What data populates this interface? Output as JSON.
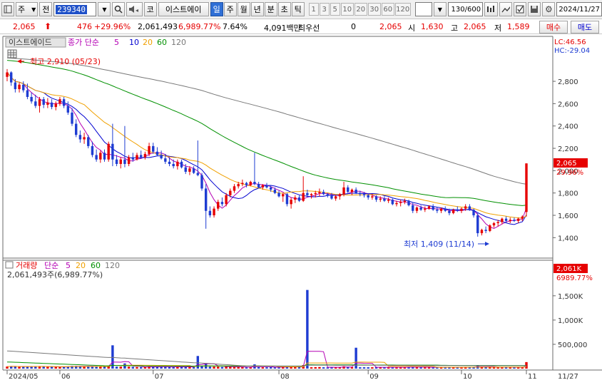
{
  "toolbar": {
    "type_selector": "주",
    "prefix_btn": "전",
    "stock_code": "239340",
    "exchange_btn": "코",
    "stock_name": "이스트에이",
    "periods": [
      "일",
      "주",
      "월",
      "년",
      "분",
      "초",
      "틱"
    ],
    "active_period": "일",
    "intervals": [
      "1",
      "3",
      "5",
      "10",
      "20",
      "30",
      "60",
      "120"
    ],
    "bar_count": "130",
    "bar_total": "/600",
    "date": "2024/11/27"
  },
  "quote": {
    "price": "2,065",
    "change": "476",
    "change_pct": "+29.96%",
    "volume": "2,061,493",
    "volume_pct": "6,989.77%",
    "turnover_pct": "7.64%",
    "amount": "4,091백만",
    "best_bid_label": "최우선",
    "best_bid_value": "0",
    "best_ask_value": "2,065",
    "open_label": "시",
    "open": "1,630",
    "high_label": "고",
    "high": "2,065",
    "low_label": "저",
    "low": "1,589",
    "buy_label": "매수",
    "sell_label": "매도"
  },
  "colors": {
    "up": "#e60000",
    "down": "#1e3cd2",
    "ma5": "#b400b4",
    "ma10": "#0000d0",
    "ma20": "#f0a000",
    "ma60": "#009000",
    "ma120": "#787878"
  },
  "price_panel": {
    "title": "이스트에이드",
    "legend_label": "종가 단순",
    "legend_periods": [
      "5",
      "10",
      "20",
      "60",
      "120"
    ],
    "lc": "LC:46.56",
    "hc": "HC:-29.04",
    "max_annotation": "최고 2,910 (05/23)",
    "min_annotation": "최저 1,409 (11/14)",
    "current_price": "2,065",
    "current_pct": "29.96%",
    "y_ticks": [
      "2,800",
      "2,600",
      "2,400",
      "2,200",
      "2,000",
      "1,800",
      "1,600",
      "1,400"
    ]
  },
  "volume_panel": {
    "legend_label": "거래량",
    "legend_sub": "단순",
    "legend_periods": [
      "5",
      "20",
      "60",
      "120"
    ],
    "info": "2,061,493주(6,989.77%)",
    "current_volume": "2,061K",
    "current_pct": "6989.77%",
    "y_ticks": [
      "1,500K",
      "1,000K",
      "500,000"
    ]
  },
  "x_axis": {
    "labels": [
      "2024/05",
      "06",
      "07",
      "08",
      "09",
      "10",
      "11"
    ],
    "right_label": "11/27"
  },
  "chart_data": {
    "type": "candlestick",
    "ylim": [
      1300,
      2960
    ],
    "volume_ylim": [
      0,
      2100000
    ],
    "candles": [
      [
        2840,
        2910,
        2800,
        2880
      ],
      [
        2880,
        2890,
        2760,
        2790
      ],
      [
        2790,
        2820,
        2700,
        2730
      ],
      [
        2730,
        2790,
        2700,
        2770
      ],
      [
        2770,
        2800,
        2700,
        2720
      ],
      [
        2720,
        2780,
        2640,
        2660
      ],
      [
        2660,
        2700,
        2600,
        2620
      ],
      [
        2620,
        2680,
        2560,
        2580
      ],
      [
        2580,
        2660,
        2520,
        2640
      ],
      [
        2640,
        2660,
        2560,
        2590
      ],
      [
        2590,
        2650,
        2560,
        2610
      ],
      [
        2610,
        2640,
        2550,
        2570
      ],
      [
        2570,
        2620,
        2540,
        2600
      ],
      [
        2600,
        2660,
        2580,
        2640
      ],
      [
        2640,
        2660,
        2560,
        2580
      ],
      [
        2580,
        2620,
        2500,
        2520
      ],
      [
        2520,
        2560,
        2400,
        2420
      ],
      [
        2420,
        2460,
        2300,
        2320
      ],
      [
        2320,
        2360,
        2250,
        2280
      ],
      [
        2280,
        2340,
        2240,
        2300
      ],
      [
        2300,
        2320,
        2200,
        2220
      ],
      [
        2220,
        2260,
        2120,
        2140
      ],
      [
        2140,
        2190,
        2080,
        2100
      ],
      [
        2100,
        2180,
        2070,
        2160
      ],
      [
        2160,
        2190,
        2080,
        2100
      ],
      [
        2100,
        2260,
        2080,
        2240
      ],
      [
        2240,
        2420,
        2040,
        2100
      ],
      [
        2100,
        2140,
        2040,
        2060
      ],
      [
        2060,
        2120,
        2020,
        2100
      ],
      [
        2100,
        2400,
        2030,
        2060
      ],
      [
        2060,
        2140,
        2040,
        2120
      ],
      [
        2120,
        2160,
        2080,
        2100
      ],
      [
        2100,
        2160,
        2090,
        2140
      ],
      [
        2140,
        2180,
        2110,
        2120
      ],
      [
        2120,
        2170,
        2100,
        2150
      ],
      [
        2150,
        2250,
        2130,
        2220
      ],
      [
        2220,
        2250,
        2150,
        2170
      ],
      [
        2170,
        2210,
        2130,
        2140
      ],
      [
        2140,
        2180,
        2100,
        2110
      ],
      [
        2110,
        2150,
        2060,
        2080
      ],
      [
        2080,
        2120,
        2040,
        2060
      ],
      [
        2060,
        2100,
        2020,
        2040
      ],
      [
        2040,
        2100,
        2010,
        2080
      ],
      [
        2080,
        2100,
        2020,
        2030
      ],
      [
        2030,
        2060,
        1970,
        1990
      ],
      [
        1990,
        2040,
        1960,
        2020
      ],
      [
        2020,
        2040,
        1970,
        1980
      ],
      [
        1980,
        2270,
        1950,
        1960
      ],
      [
        1960,
        1980,
        1820,
        1840
      ],
      [
        1840,
        1880,
        1480,
        1640
      ],
      [
        1640,
        1680,
        1580,
        1600
      ],
      [
        1600,
        1680,
        1580,
        1660
      ],
      [
        1660,
        1740,
        1640,
        1720
      ],
      [
        1720,
        1760,
        1680,
        1700
      ],
      [
        1700,
        1800,
        1680,
        1780
      ],
      [
        1780,
        1840,
        1760,
        1820
      ],
      [
        1820,
        1880,
        1800,
        1860
      ],
      [
        1860,
        1900,
        1840,
        1880
      ],
      [
        1880,
        1920,
        1860,
        1890
      ],
      [
        1890,
        1900,
        1850,
        1870
      ],
      [
        1870,
        1910,
        1860,
        1900
      ],
      [
        1900,
        2160,
        1870,
        1880
      ],
      [
        1880,
        1900,
        1840,
        1850
      ],
      [
        1850,
        1880,
        1830,
        1870
      ],
      [
        1870,
        1890,
        1840,
        1850
      ],
      [
        1850,
        1870,
        1810,
        1830
      ],
      [
        1830,
        1850,
        1790,
        1800
      ],
      [
        1800,
        1820,
        1760,
        1770
      ],
      [
        1770,
        1800,
        1720,
        1790
      ],
      [
        1790,
        1800,
        1680,
        1700
      ],
      [
        1700,
        1760,
        1660,
        1740
      ],
      [
        1740,
        1780,
        1710,
        1760
      ],
      [
        1760,
        1780,
        1720,
        1730
      ],
      [
        1730,
        1950,
        1720,
        1800
      ],
      [
        1800,
        1830,
        1760,
        1780
      ],
      [
        1780,
        1800,
        1750,
        1790
      ],
      [
        1790,
        1820,
        1760,
        1800
      ],
      [
        1800,
        1840,
        1770,
        1810
      ],
      [
        1810,
        1830,
        1780,
        1790
      ],
      [
        1790,
        1800,
        1760,
        1780
      ],
      [
        1780,
        1800,
        1740,
        1750
      ],
      [
        1750,
        1780,
        1730,
        1770
      ],
      [
        1770,
        1800,
        1740,
        1790
      ],
      [
        1790,
        1900,
        1770,
        1850
      ],
      [
        1850,
        1870,
        1790,
        1810
      ],
      [
        1810,
        1840,
        1780,
        1830
      ],
      [
        1830,
        1850,
        1790,
        1800
      ],
      [
        1800,
        1820,
        1770,
        1790
      ],
      [
        1790,
        1810,
        1760,
        1780
      ],
      [
        1780,
        1790,
        1740,
        1760
      ],
      [
        1760,
        1790,
        1740,
        1770
      ],
      [
        1770,
        1780,
        1720,
        1740
      ],
      [
        1740,
        1770,
        1720,
        1750
      ],
      [
        1750,
        1770,
        1720,
        1730
      ],
      [
        1730,
        1760,
        1710,
        1740
      ],
      [
        1740,
        1750,
        1690,
        1700
      ],
      [
        1700,
        1730,
        1680,
        1710
      ],
      [
        1710,
        1740,
        1680,
        1720
      ],
      [
        1720,
        1750,
        1700,
        1730
      ],
      [
        1730,
        1740,
        1680,
        1690
      ],
      [
        1690,
        1710,
        1620,
        1640
      ],
      [
        1640,
        1680,
        1620,
        1670
      ],
      [
        1670,
        1690,
        1640,
        1650
      ],
      [
        1650,
        1680,
        1630,
        1660
      ],
      [
        1660,
        1690,
        1650,
        1680
      ],
      [
        1680,
        1700,
        1640,
        1650
      ],
      [
        1650,
        1670,
        1620,
        1640
      ],
      [
        1640,
        1670,
        1620,
        1660
      ],
      [
        1660,
        1680,
        1630,
        1640
      ],
      [
        1640,
        1660,
        1600,
        1620
      ],
      [
        1620,
        1660,
        1610,
        1650
      ],
      [
        1650,
        1680,
        1630,
        1640
      ],
      [
        1640,
        1670,
        1620,
        1660
      ],
      [
        1660,
        1700,
        1640,
        1680
      ],
      [
        1680,
        1700,
        1640,
        1650
      ],
      [
        1650,
        1660,
        1580,
        1600
      ],
      [
        1600,
        1620,
        1409,
        1440
      ],
      [
        1440,
        1480,
        1420,
        1470
      ],
      [
        1470,
        1500,
        1440,
        1460
      ],
      [
        1460,
        1520,
        1450,
        1510
      ],
      [
        1510,
        1540,
        1490,
        1530
      ],
      [
        1530,
        1560,
        1500,
        1540
      ],
      [
        1540,
        1580,
        1520,
        1570
      ],
      [
        1570,
        1590,
        1530,
        1550
      ],
      [
        1550,
        1580,
        1530,
        1560
      ],
      [
        1560,
        1580,
        1540,
        1550
      ],
      [
        1550,
        1580,
        1530,
        1570
      ],
      [
        1570,
        1600,
        1550,
        1589
      ],
      [
        1630,
        2065,
        1589,
        2065
      ]
    ],
    "ma_period_labels": [
      "5",
      "10",
      "20",
      "60",
      "120"
    ],
    "volume_spikes": {
      "26": 480000,
      "47": 260000,
      "74": 1620000,
      "86": 430000,
      "130": 2061493
    }
  }
}
